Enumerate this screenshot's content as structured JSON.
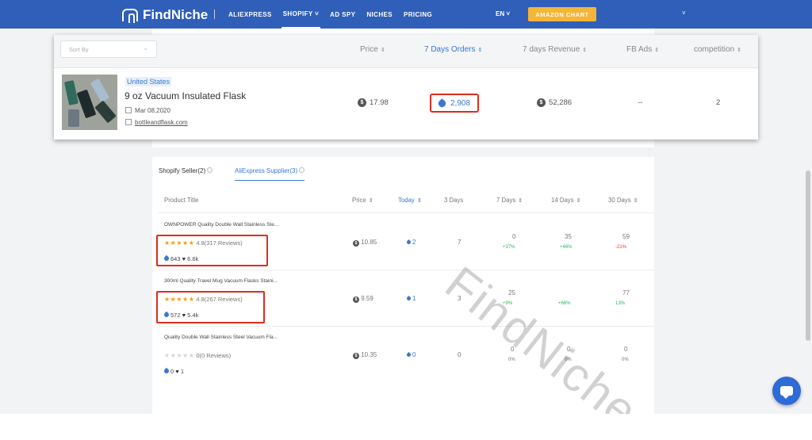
{
  "nav": {
    "brand": "FindNiche",
    "items": [
      "ALIEXPRESS",
      "SHOPIFY ˅",
      "AD SPY",
      "NICHES",
      "PRICING"
    ],
    "lang": "EN ˅",
    "amazon": "AMAZON CHART",
    "user_caret": "˅"
  },
  "overlay": {
    "sort_placeholder": "Sort By",
    "columns": [
      "Price",
      "7 Days Orders",
      "7 days Revenue",
      "FB Ads",
      "competition"
    ],
    "product": {
      "country": "United States",
      "title": "9 oz Vacuum Insulated Flask",
      "date": "Mar 08,2020",
      "store": "bottleandflask.com",
      "price": "17.98",
      "orders": "2,908",
      "revenue": "52,286",
      "fb_ads": "--",
      "competition": "2"
    }
  },
  "detail": {
    "tabs": [
      "Shopify Seller(2)",
      "AliExpress Supplier(3)"
    ],
    "headers": [
      "Product Title",
      "Price",
      "Today",
      "3 Days",
      "7 Days",
      "14 Days",
      "30 Days"
    ],
    "rows": [
      {
        "title": "OWNPOWER Quality Double Wall Stainless Ste...",
        "stars": "★★★★★",
        "rating": "4.8(317 Reviews)",
        "orders": "643",
        "likes": "6.6k",
        "price": "10.85",
        "today": "2",
        "d3": "7",
        "d7": "0",
        "d7p": "+37%",
        "d14": "35",
        "d14p": "+46%",
        "d30": "59",
        "d30p": "-21%"
      },
      {
        "title": "300ml Quality Travel Mug Vacuum Flasks Staini...",
        "stars": "★★★★★",
        "rating": "4.8(267 Reviews)",
        "orders": "572",
        "likes": "5.4k",
        "price": "9.59",
        "today": "1",
        "d3": "3",
        "d7": "25",
        "d7p": "+9%",
        "d14": "",
        "d14p": "+66%",
        "d30": "77",
        "d30p": "13%"
      },
      {
        "title": "Quality Double Wall Stainless Steel Vacuum Fla...",
        "stars": "★★★★★",
        "rating": "0(0 Reviews)",
        "orders": "0",
        "likes": "1",
        "price": "10.35",
        "today": "0",
        "d3": "0",
        "d7": "0",
        "d7p": "0%",
        "d14": "0",
        "d14p": "0%",
        "d30": "0",
        "d30p": "0%"
      }
    ]
  },
  "watermark": "FindNiche",
  "colors": {
    "nav": "#2f5fb9",
    "accent": "#3a78d0",
    "highlight": "#e02c1c",
    "star": "#f39b12",
    "amazon": "#f5b537"
  }
}
